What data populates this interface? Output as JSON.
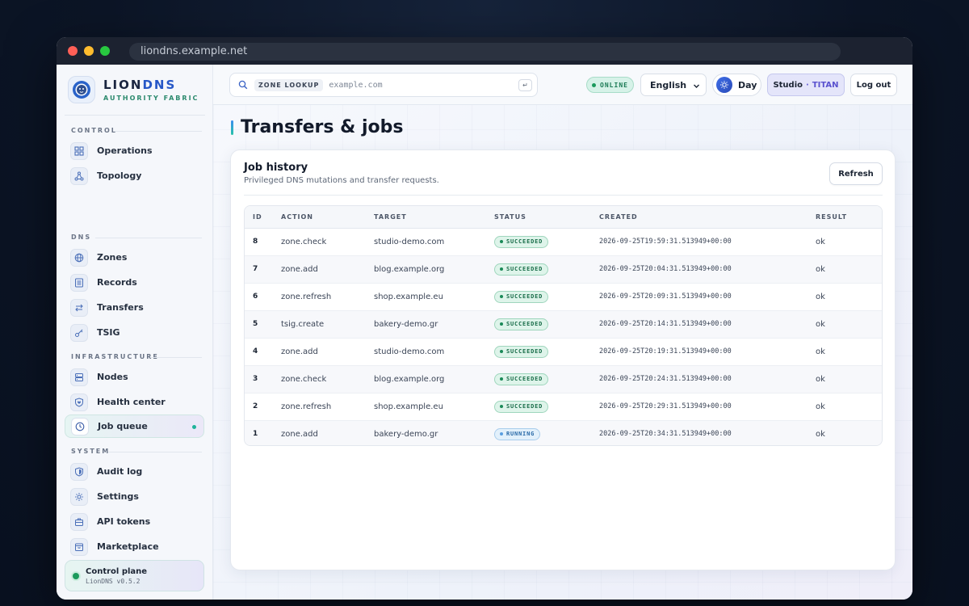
{
  "browser": {
    "url": "liondns.example.net"
  },
  "brand": {
    "name_part1": "LION",
    "name_part2": "DNS",
    "subtitle": "AUTHORITY FABRIC"
  },
  "sidebar": {
    "sections": [
      {
        "label": "CONTROL",
        "items": [
          {
            "label": "Operations",
            "icon": "grid-icon"
          },
          {
            "label": "Topology",
            "icon": "network-icon"
          }
        ]
      },
      {
        "label": "DNS",
        "items": [
          {
            "label": "Zones",
            "icon": "globe-icon"
          },
          {
            "label": "Records",
            "icon": "list-icon"
          },
          {
            "label": "Transfers",
            "icon": "swap-icon"
          },
          {
            "label": "TSIG",
            "icon": "key-icon"
          }
        ]
      },
      {
        "label": "INFRASTRUCTURE",
        "items": [
          {
            "label": "Nodes",
            "icon": "server-icon"
          },
          {
            "label": "Health center",
            "icon": "heart-shield-icon"
          },
          {
            "label": "Job queue",
            "icon": "clock-icon",
            "active": true
          }
        ]
      },
      {
        "label": "SYSTEM",
        "items": [
          {
            "label": "Audit log",
            "icon": "shield-icon"
          },
          {
            "label": "Settings",
            "icon": "gear-icon"
          },
          {
            "label": "API tokens",
            "icon": "briefcase-icon"
          },
          {
            "label": "Marketplace",
            "icon": "store-icon"
          }
        ]
      }
    ],
    "control_plane": {
      "title": "Control plane",
      "version": "LionDNS v0.5.2"
    }
  },
  "topbar": {
    "search_tag": "ZONE LOOKUP",
    "search_placeholder": "example.com",
    "enter_key": "↵",
    "status": "ONLINE",
    "language": "English",
    "theme": "Day",
    "studio_label": "Studio",
    "studio_sep": "·",
    "studio_org": "TITAN",
    "logout": "Log out"
  },
  "page": {
    "title": "Transfers & jobs"
  },
  "card": {
    "title": "Job history",
    "subtitle": "Privileged DNS mutations and transfer requests.",
    "refresh": "Refresh"
  },
  "table": {
    "columns": [
      "ID",
      "ACTION",
      "TARGET",
      "STATUS",
      "CREATED",
      "RESULT"
    ],
    "rows": [
      {
        "id": "8",
        "action": "zone.check",
        "target": "studio-demo.com",
        "status": "SUCCEEDED",
        "created": "2026-09-25T19:59:31.513949+00:00",
        "result": "ok"
      },
      {
        "id": "7",
        "action": "zone.add",
        "target": "blog.example.org",
        "status": "SUCCEEDED",
        "created": "2026-09-25T20:04:31.513949+00:00",
        "result": "ok"
      },
      {
        "id": "6",
        "action": "zone.refresh",
        "target": "shop.example.eu",
        "status": "SUCCEEDED",
        "created": "2026-09-25T20:09:31.513949+00:00",
        "result": "ok"
      },
      {
        "id": "5",
        "action": "tsig.create",
        "target": "bakery-demo.gr",
        "status": "SUCCEEDED",
        "created": "2026-09-25T20:14:31.513949+00:00",
        "result": "ok"
      },
      {
        "id": "4",
        "action": "zone.add",
        "target": "studio-demo.com",
        "status": "SUCCEEDED",
        "created": "2026-09-25T20:19:31.513949+00:00",
        "result": "ok"
      },
      {
        "id": "3",
        "action": "zone.check",
        "target": "blog.example.org",
        "status": "SUCCEEDED",
        "created": "2026-09-25T20:24:31.513949+00:00",
        "result": "ok"
      },
      {
        "id": "2",
        "action": "zone.refresh",
        "target": "shop.example.eu",
        "status": "SUCCEEDED",
        "created": "2026-09-25T20:29:31.513949+00:00",
        "result": "ok"
      },
      {
        "id": "1",
        "action": "zone.add",
        "target": "bakery-demo.gr",
        "status": "RUNNING",
        "created": "2026-09-25T20:34:31.513949+00:00",
        "result": "ok"
      }
    ]
  },
  "colors": {
    "accent": "#2657c7",
    "success": "#1b9a5c",
    "running": "#5a9ee0",
    "active_dot": "#1fb39a"
  }
}
